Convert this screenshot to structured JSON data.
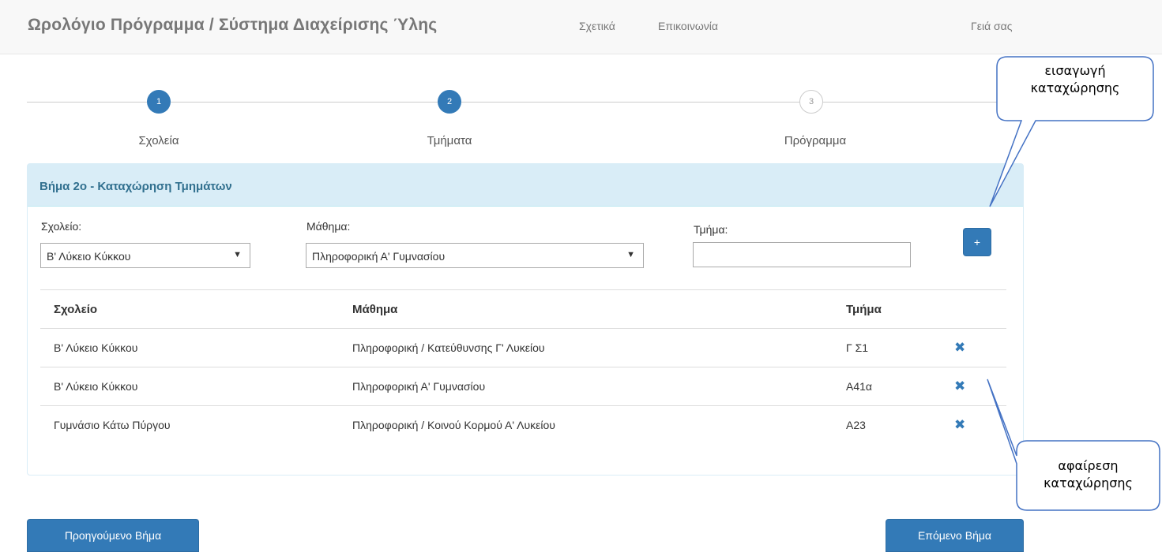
{
  "navbar": {
    "brand": "Ωρολόγιο Πρόγραμμα / Σύστημα Διαχείρισης Ύλης",
    "about": "Σχετικά",
    "contact": "Επικοινωνία",
    "greeting": "Γειά σας"
  },
  "steps": [
    {
      "number": "1",
      "label": "Σχολεία",
      "state": "done"
    },
    {
      "number": "2",
      "label": "Τμήματα",
      "state": "done"
    },
    {
      "number": "3",
      "label": "Πρόγραμμα",
      "state": "pending"
    }
  ],
  "panel": {
    "title": "Βήμα 2ο - Καταχώρηση Τμημάτων"
  },
  "form": {
    "school_label": "Σχολείο:",
    "school_value": "Β' Λύκειο Κύκκου",
    "course_label": "Μάθημα:",
    "course_value": "Πληροφορική Α' Γυμνασίου",
    "class_label": "Τμήμα:",
    "class_value": "",
    "add_label": "+"
  },
  "table": {
    "headers": {
      "school": "Σχολείο",
      "course": "Μάθημα",
      "class": "Τμήμα"
    },
    "rows": [
      {
        "school": "Β' Λύκειο Κύκκου",
        "course": "Πληροφορική / Κατεύθυνσης Γ' Λυκείου",
        "class": "Γ Σ1"
      },
      {
        "school": "Β' Λύκειο Κύκκου",
        "course": "Πληροφορική Α' Γυμνασίου",
        "class": "Α41α"
      },
      {
        "school": "Γυμνάσιο Κάτω Πύργου",
        "course": "Πληροφορική / Κοινού Κορμού Α' Λυκείου",
        "class": "Α23"
      }
    ],
    "remove_glyph": "✖"
  },
  "buttons": {
    "prev": "Προηγούμενο Βήμα",
    "next": "Επόμενο Βήμα"
  },
  "callouts": {
    "add_line1": "εισαγωγή",
    "add_line2": "καταχώρησης",
    "remove_line1": "αφαίρεση",
    "remove_line2": "καταχώρησης"
  },
  "colors": {
    "primary": "#337ab7",
    "panel_heading_bg": "#d9edf7",
    "panel_title": "#31708f",
    "navbar_bg": "#f8f8f8"
  }
}
